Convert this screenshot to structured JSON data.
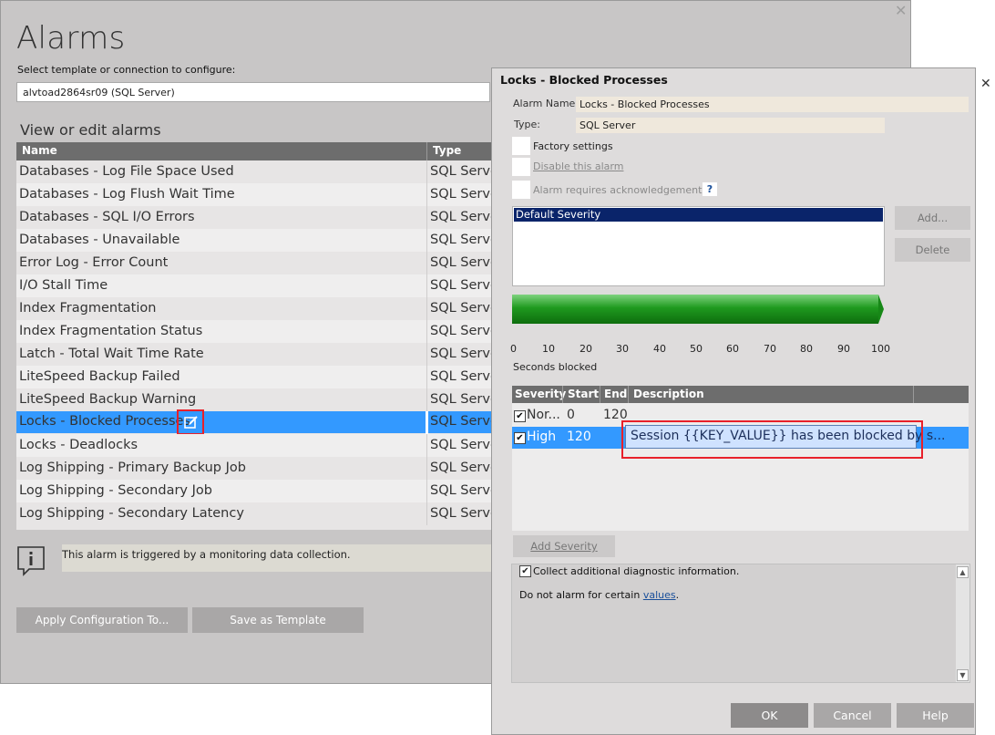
{
  "main": {
    "title": "Alarms",
    "select_label": "Select template or connection to configure:",
    "connection_value": "alvtoad2864sr09 (SQL Server)",
    "view_label": "View or edit alarms",
    "columns": [
      "Name",
      "Type"
    ],
    "rows": [
      {
        "name": "Databases - Log File Space Used",
        "type": "SQL Serve"
      },
      {
        "name": "Databases - Log Flush Wait Time",
        "type": "SQL Serve"
      },
      {
        "name": "Databases - SQL I/O Errors",
        "type": "SQL Serve"
      },
      {
        "name": "Databases - Unavailable",
        "type": "SQL Serve"
      },
      {
        "name": "Error Log - Error Count",
        "type": "SQL Serve"
      },
      {
        "name": "I/O Stall Time",
        "type": "SQL Serve"
      },
      {
        "name": "Index Fragmentation",
        "type": "SQL Serve"
      },
      {
        "name": "Index Fragmentation Status",
        "type": "SQL Serve"
      },
      {
        "name": "Latch - Total Wait Time Rate",
        "type": "SQL Serve"
      },
      {
        "name": "LiteSpeed Backup Failed",
        "type": "SQL Serve"
      },
      {
        "name": "LiteSpeed Backup Warning",
        "type": "SQL Serve"
      },
      {
        "name": "Locks - Blocked Processes",
        "type": "SQL Serve"
      },
      {
        "name": "Locks - Deadlocks",
        "type": "SQL Serve"
      },
      {
        "name": "Log Shipping - Primary Backup Job",
        "type": "SQL Serve"
      },
      {
        "name": "Log Shipping - Secondary Job",
        "type": "SQL Serve"
      },
      {
        "name": "Log Shipping - Secondary Latency",
        "type": "SQL Serve"
      }
    ],
    "info_text": "This alarm is triggered by a monitoring data collection.",
    "apply_button": "Apply Configuration To...",
    "template_button": "Save as Template",
    "close_icon": "close-icon",
    "info_icon": "info-icon"
  },
  "dialog": {
    "title": "Locks - Blocked Processes",
    "alarm_name_label": "Alarm Name:",
    "alarm_name_value": "Locks - Blocked Processes",
    "type_label": "Type:",
    "type_value": "SQL Server",
    "factory_label": "Factory settings",
    "disable_label": "Disable this alarm",
    "ack_label": "Alarm requires acknowledgement",
    "help_glyph": "?",
    "severity_list_item": "Default Severity",
    "add_button": "Add...",
    "delete_button": "Delete",
    "range_ticks": [
      "0",
      "10",
      "20",
      "30",
      "40",
      "50",
      "60",
      "70",
      "80",
      "90",
      "100"
    ],
    "range_unit": "Seconds blocked",
    "range_fill": 1.0,
    "grid_columns": [
      "Severity",
      "Start",
      "End",
      "Description"
    ],
    "grid_rows": [
      {
        "checked": "✔",
        "severity": "Nor...",
        "start": "0",
        "end": "120",
        "description": ""
      },
      {
        "checked": "✔",
        "severity": "High",
        "start": "120",
        "end": "",
        "description": "Session {{KEY_VALUE}} has been blocked by s..."
      }
    ],
    "add_severity_button": "Add Severity",
    "diagnostic_checked": "✔",
    "diagnostic_label": "Collect additional diagnostic information.",
    "no_alarm_prefix": "Do not alarm for certain ",
    "no_alarm_link": "values",
    "no_alarm_suffix": ".",
    "ok_button": "OK",
    "cancel_button": "Cancel",
    "help_button": "Help",
    "colors": {
      "selection": "#3399ff",
      "highlight_box": "#e8202a",
      "bar": "#1f9a1f",
      "header": "#6d6d6d"
    }
  }
}
